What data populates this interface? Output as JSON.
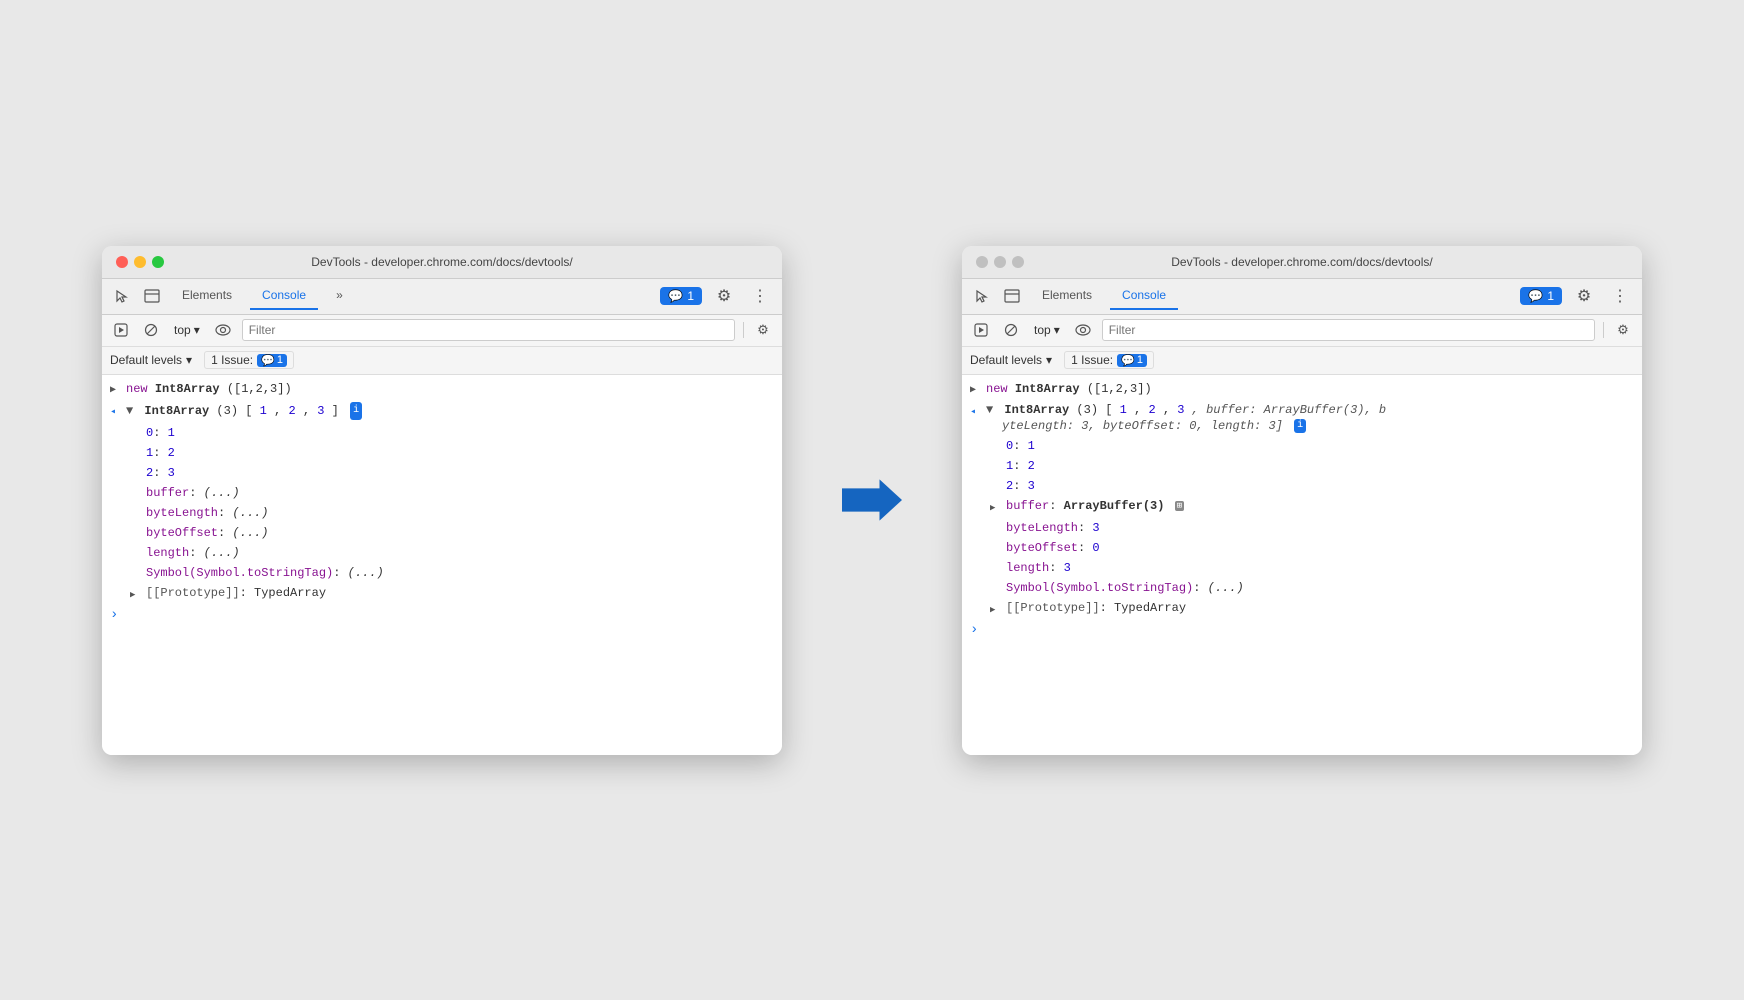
{
  "left_window": {
    "title": "DevTools - developer.chrome.com/docs/devtools/",
    "tabs": [
      "Elements",
      "Console",
      "»"
    ],
    "active_tab": "Console",
    "badge": "1",
    "filter_placeholder": "Filter",
    "context": "top",
    "default_levels": "Default levels",
    "issues": "1 Issue:",
    "issues_count": "1",
    "console_lines": [
      {
        "type": "input",
        "text": "new Int8Array([1,2,3])"
      },
      {
        "type": "output_header",
        "text": "Int8Array(3) [1, 2, 3]"
      },
      {
        "type": "prop",
        "indent": 1,
        "key": "0:",
        "val": "1"
      },
      {
        "type": "prop",
        "indent": 1,
        "key": "1:",
        "val": "2"
      },
      {
        "type": "prop",
        "indent": 1,
        "key": "2:",
        "val": "3"
      },
      {
        "type": "prop_lazy",
        "indent": 1,
        "key": "buffer:",
        "val": "(...)"
      },
      {
        "type": "prop_lazy",
        "indent": 1,
        "key": "byteLength:",
        "val": "(...)"
      },
      {
        "type": "prop_lazy",
        "indent": 1,
        "key": "byteOffset:",
        "val": "(...)"
      },
      {
        "type": "prop_lazy",
        "indent": 1,
        "key": "length:",
        "val": "(...)"
      },
      {
        "type": "prop_lazy",
        "indent": 1,
        "key": "Symbol(Symbol.toStringTag):",
        "val": "(...)"
      },
      {
        "type": "proto",
        "indent": 1,
        "text": "[[Prototype]]: TypedArray"
      }
    ]
  },
  "right_window": {
    "title": "DevTools - developer.chrome.com/docs/devtools/",
    "tabs": [
      "Elements",
      "Console"
    ],
    "active_tab": "Console",
    "badge": "1",
    "filter_placeholder": "Filter",
    "context": "top",
    "default_levels": "Default levels",
    "issues": "1 Issue:",
    "issues_count": "1",
    "console_lines": [
      {
        "type": "input",
        "text": "new Int8Array([1,2,3])"
      },
      {
        "type": "output_header_expanded",
        "text": "Int8Array(3) [1, 2, 3, buffer: ArrayBuffer(3), byteLength: 3, byteOffset: 0, length: 3]"
      },
      {
        "type": "prop",
        "indent": 1,
        "key": "0:",
        "val": "1"
      },
      {
        "type": "prop",
        "indent": 1,
        "key": "1:",
        "val": "2"
      },
      {
        "type": "prop",
        "indent": 1,
        "key": "2:",
        "val": "3"
      },
      {
        "type": "prop_buffer",
        "indent": 1,
        "key": "buffer:",
        "val": "ArrayBuffer(3)",
        "arrow": true
      },
      {
        "type": "prop_value",
        "indent": 1,
        "key": "byteLength:",
        "val": "3"
      },
      {
        "type": "prop_value",
        "indent": 1,
        "key": "byteOffset:",
        "val": "0"
      },
      {
        "type": "prop_value",
        "indent": 1,
        "key": "length:",
        "val": "3"
      },
      {
        "type": "prop_lazy",
        "indent": 1,
        "key": "Symbol(Symbol.toStringTag):",
        "val": "(...)"
      },
      {
        "type": "proto",
        "indent": 1,
        "text": "[[Prototype]]: TypedArray"
      }
    ]
  },
  "icons": {
    "cursor": "⬚",
    "copy": "⊡",
    "clear": "⊘",
    "eye": "👁",
    "gear": "⚙",
    "more": "⋮",
    "chevron_down": "▾",
    "triangle_right": "▶",
    "triangle_down": "▼",
    "chat": "💬",
    "expand_left": "◂",
    "play": "▶"
  }
}
